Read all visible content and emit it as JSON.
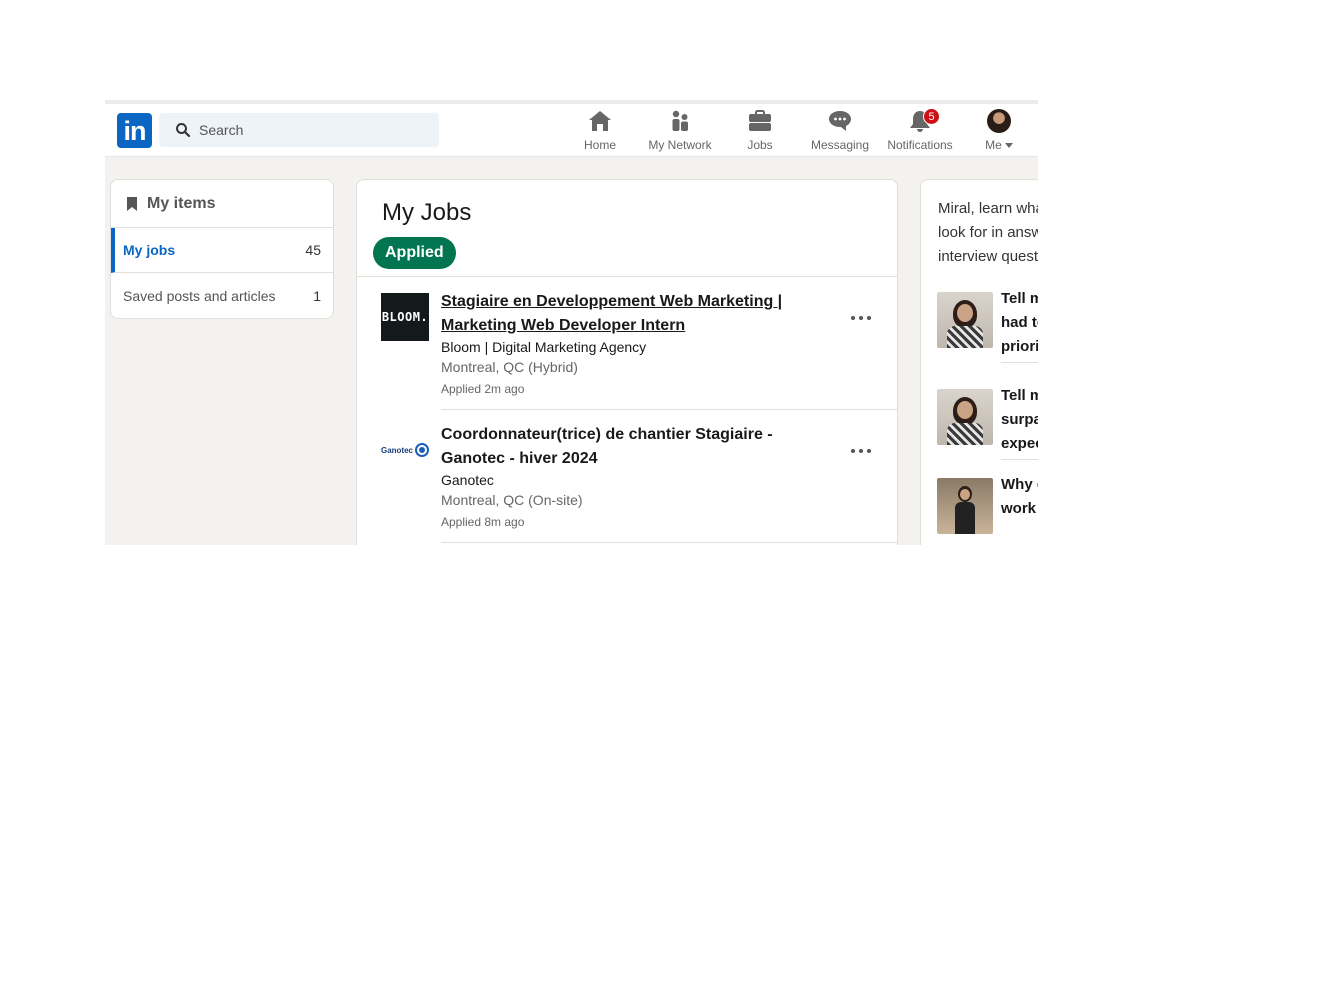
{
  "header": {
    "logo_text": "in",
    "search_placeholder": "Search",
    "nav": {
      "home": "Home",
      "network": "My Network",
      "jobs": "Jobs",
      "messaging": "Messaging",
      "notifications": "Notifications",
      "notifications_count": "5",
      "me": "Me"
    }
  },
  "sidebar": {
    "title": "My items",
    "items": [
      {
        "label": "My jobs",
        "count": "45"
      },
      {
        "label": "Saved posts and articles",
        "count": "1"
      }
    ]
  },
  "main": {
    "title": "My Jobs",
    "filter_pill": "Applied",
    "jobs": [
      {
        "logo_text": "BLOOM.",
        "title": "Stagiaire en Developpement Web Marketing | Marketing Web Developer Intern",
        "company": "Bloom | Digital Marketing Agency",
        "location": "Montreal, QC (Hybrid)",
        "status": "Applied 2m ago"
      },
      {
        "logo_text": "Ganotec",
        "title": "Coordonnateur(trice) de chantier Stagiaire - Ganotec - hiver 2024",
        "company": "Ganotec",
        "location": "Montreal, QC (On-site)",
        "status": "Applied 8m ago"
      }
    ]
  },
  "right_panel": {
    "intro": "Miral, learn what hiring managers look for in answers to top interview questions",
    "items": [
      {
        "text": "Tell me about a time you had to handle multiple priorities"
      },
      {
        "text": "Tell me about a time you surpassed people's expectations"
      },
      {
        "text": "Why do you want to work here?"
      }
    ]
  },
  "colors": {
    "brand": "#0a66c2",
    "pill": "#01754f",
    "badge": "#cc1016",
    "background": "#f3f2ef"
  }
}
